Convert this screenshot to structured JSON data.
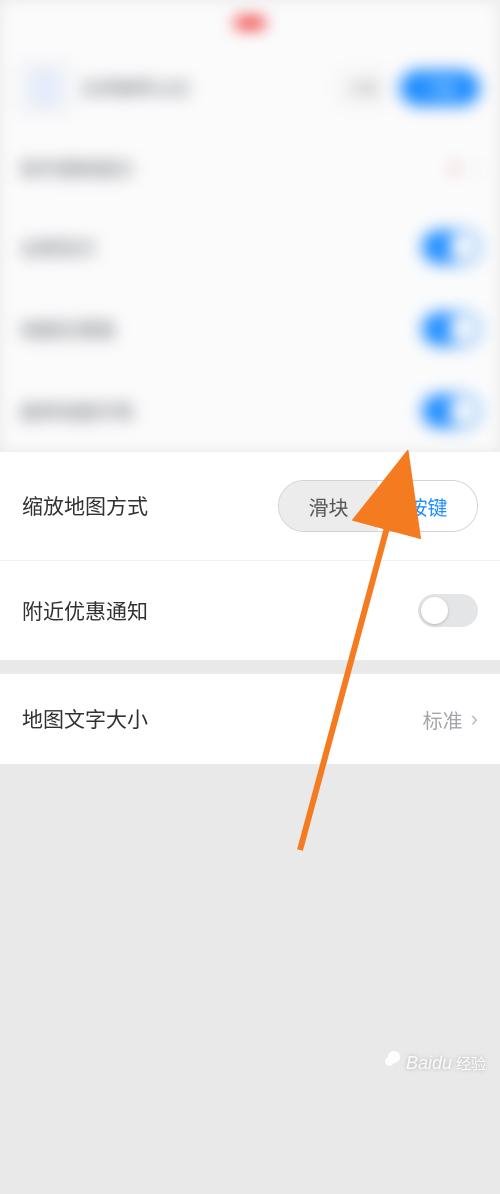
{
  "blurred": {
    "row1_primary_button": "下载",
    "row1_secondary_button": "详情",
    "toggles": [
      {
        "label": "全屏显示"
      },
      {
        "label": "地图实景图"
      },
      {
        "label": "旋转地图手势"
      }
    ]
  },
  "settings": {
    "zoom_method": {
      "label": "缩放地图方式",
      "option_slider": "滑块",
      "option_button": "按键",
      "selected": "按键"
    },
    "nearby_deals": {
      "label": "附近优惠通知",
      "enabled": false
    },
    "text_size": {
      "label": "地图文字大小",
      "value": "标准"
    }
  },
  "watermark": {
    "text": "Baidu",
    "suffix": "经验"
  }
}
